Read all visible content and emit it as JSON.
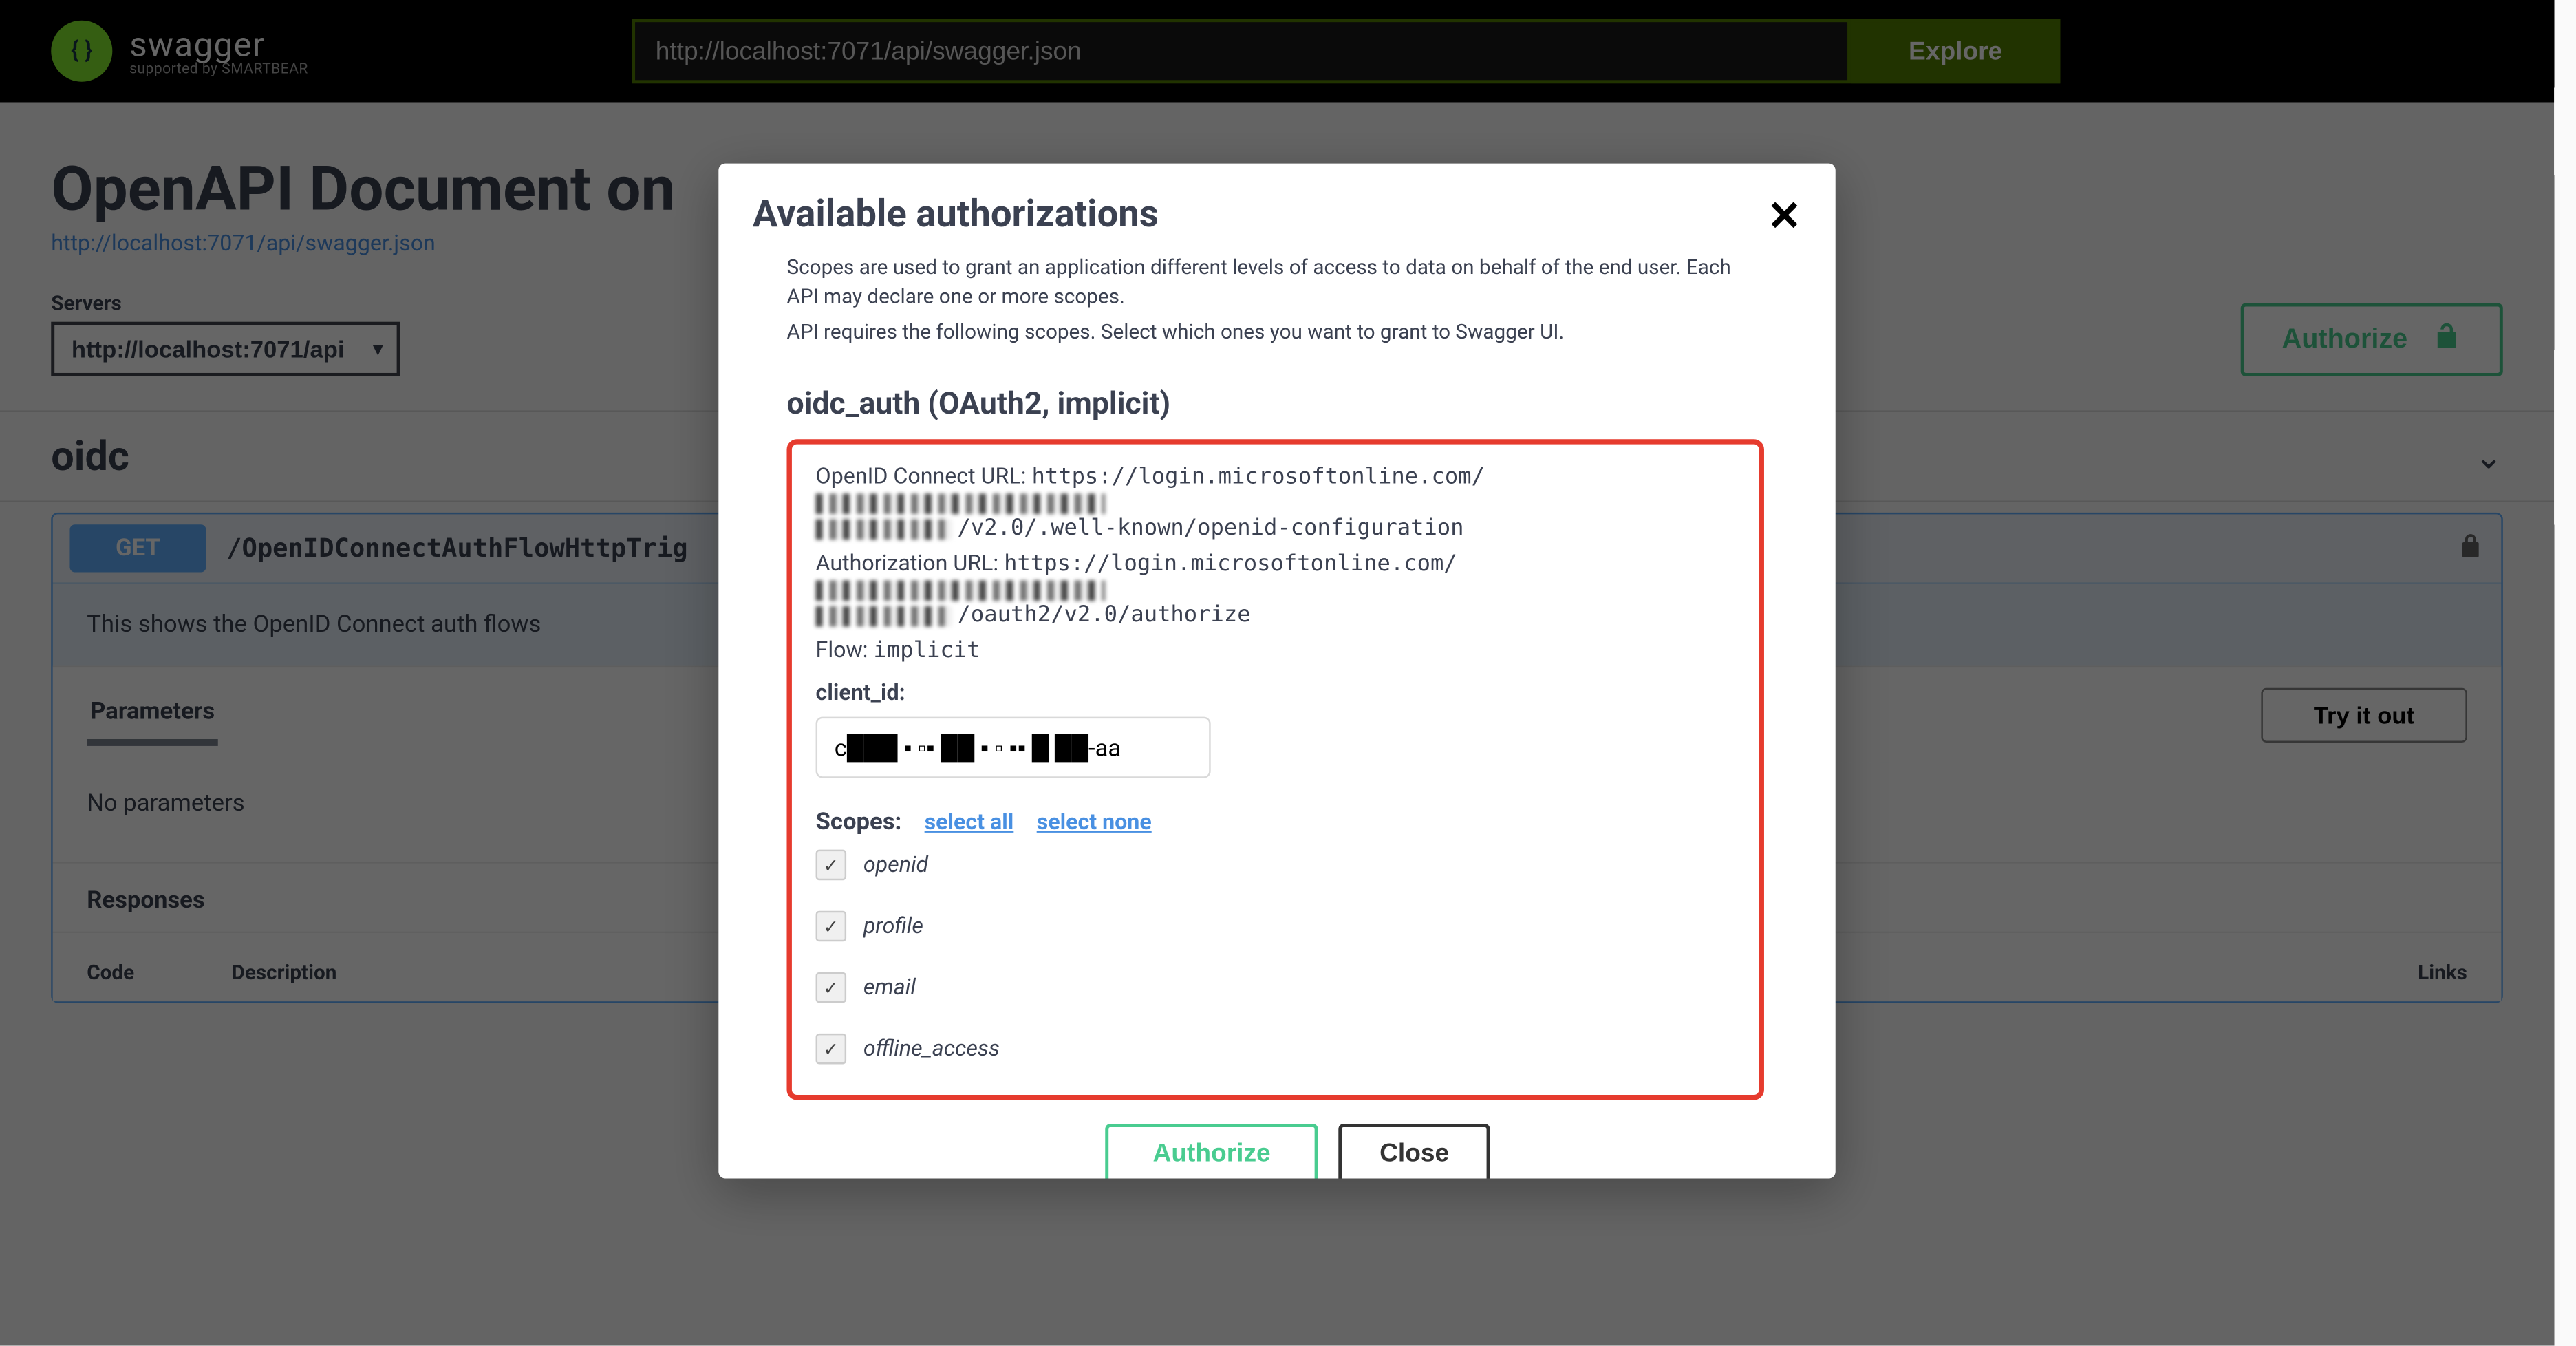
{
  "topbar": {
    "logo_text": "swagger",
    "logo_sub": "supported by SMARTBEAR",
    "url_value": "http://localhost:7071/api/swagger.json",
    "explore_label": "Explore"
  },
  "info": {
    "title": "OpenAPI Document on",
    "spec_url": "http://localhost:7071/api/swagger.json"
  },
  "servers": {
    "label": "Servers",
    "selected": "http://localhost:7071/api"
  },
  "authorize_main_label": "Authorize",
  "tag": {
    "name": "oidc"
  },
  "operation": {
    "method": "GET",
    "path": "/OpenIDConnectAuthFlowHttpTrig",
    "description": "This shows the OpenID Connect auth flows",
    "parameters_label": "Parameters",
    "try_label": "Try it out",
    "no_params": "No parameters",
    "responses_label": "Responses",
    "col_code": "Code",
    "col_desc": "Description",
    "col_links": "Links"
  },
  "modal": {
    "title": "Available authorizations",
    "scopes_desc1": "Scopes are used to grant an application different levels of access to data on behalf of the end user. Each API may declare one or more scopes.",
    "scopes_desc2": "API requires the following scopes. Select which ones you want to grant to Swagger UI.",
    "auth_title": "oidc_auth (OAuth2, implicit)",
    "openid_label": "OpenID Connect URL:",
    "openid_url_prefix": "https://login.microsoftonline.com/",
    "openid_url_suffix": "/v2.0/.well-known/openid-configuration",
    "authz_label": "Authorization URL:",
    "authz_url_prefix": "https://login.microsoftonline.com/",
    "authz_url_suffix": "/oauth2/v2.0/authorize",
    "flow_label": "Flow:",
    "flow_value": "implicit",
    "client_id_label": "client_id:",
    "client_id_value": "c███ ▪ ▫▪ ██ ▪ ▫ ▪▪ █ ██-aa",
    "scopes_label": "Scopes:",
    "select_all": "select all",
    "select_none": "select none",
    "scopes": [
      {
        "name": "openid",
        "checked": true
      },
      {
        "name": "profile",
        "checked": true
      },
      {
        "name": "email",
        "checked": true
      },
      {
        "name": "offline_access",
        "checked": true
      }
    ],
    "authorize_label": "Authorize",
    "close_label": "Close"
  }
}
